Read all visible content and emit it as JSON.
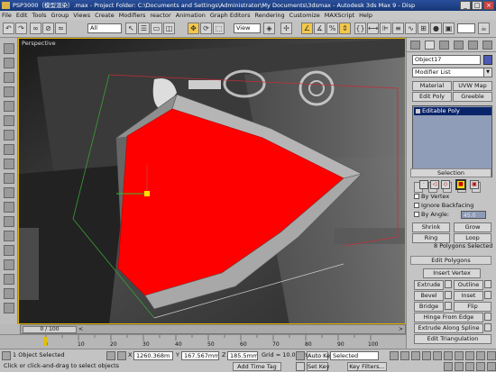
{
  "titlebar": {
    "title": "PSP3000（模型渲染）.max  - Project Folder: C:\\Documents and Settings\\Administrator\\My Documents\\3dsmax  - Autodesk 3ds Max 9  - Disp",
    "buttons": [
      "_",
      "□",
      "×"
    ]
  },
  "menu": [
    "File",
    "Edit",
    "Tools",
    "Group",
    "Views",
    "Create",
    "Modifiers",
    "reactor",
    "Animation",
    "Graph Editors",
    "Rendering",
    "Customize",
    "MAXScript",
    "Help"
  ],
  "toolbar": {
    "selection_filter": "All",
    "reference_coord": "View"
  },
  "viewport": {
    "label": "Perspective",
    "accent_color": "#ff1a1a"
  },
  "command_panel": {
    "object_name": "Object17",
    "object_color": "#4c5ab8",
    "modifier_list": "Modifier List",
    "buttons": {
      "material": "Material",
      "uvw_map": "UVW Map",
      "edit_poly": "Edit Poly",
      "greeble": "Greeble"
    },
    "stack_item": "Editable Poly",
    "selection": {
      "title": "Selection",
      "by_vertex": "By Vertex",
      "ignore_backfacing": "Ignore Backfacing",
      "by_angle": "By Angle:",
      "by_angle_value": "45.0",
      "shrink": "Shrink",
      "grow": "Grow",
      "ring": "Ring",
      "loop": "Loop",
      "status": "8 Polygons Selected"
    },
    "edit_polygons": {
      "title": "Edit Polygons",
      "insert_vertex": "Insert Vertex",
      "extrude": "Extrude",
      "outline": "Outline",
      "bevel": "Bevel",
      "inset": "Inset",
      "bridge": "Bridge",
      "flip": "Flip",
      "hinge": "Hinge From Edge",
      "extrude_spline": "Extrude Along Spline",
      "edit_triangulation": "Edit Triangulation"
    }
  },
  "timeline": {
    "slider_label": "0 / 100",
    "ticks": [
      "0",
      "10",
      "20",
      "30",
      "40",
      "50",
      "60",
      "70",
      "80",
      "90",
      "100"
    ]
  },
  "statusbar": {
    "selected": "1 Object Selected",
    "prompt": "Click or click-and-drag to select objects",
    "x_label": "X",
    "x": "1260.368m",
    "y_label": "Y",
    "y": "167.567mm",
    "z_label": "Z",
    "z": "185.5mm",
    "grid": "Grid = 10.0mm",
    "add_time_tag": "Add Time Tag",
    "auto_key": "Auto Key",
    "set_key": "Set Key",
    "selected_dropdown": "Selected",
    "key_filters": "Key Filters..."
  }
}
